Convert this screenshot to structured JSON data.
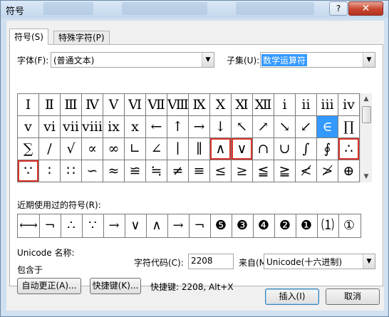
{
  "dialog": {
    "title": "符号",
    "help_glyph": "?",
    "close_glyph": "✕"
  },
  "tabs": [
    "符号(S)",
    "特殊字符(P)"
  ],
  "font": {
    "label": "字体(F):",
    "value": "(普通文本)"
  },
  "subset": {
    "label": "子集(U):",
    "value": "数学运算符"
  },
  "symbols": [
    [
      "Ⅰ",
      "Ⅱ",
      "Ⅲ",
      "Ⅳ",
      "Ⅴ",
      "Ⅵ",
      "Ⅶ",
      "Ⅷ",
      "Ⅸ",
      "Ⅹ",
      "Ⅺ",
      "Ⅻ",
      "ⅰ",
      "ⅱ",
      "ⅲ",
      "ⅳ"
    ],
    [
      "ⅴ",
      "ⅵ",
      "ⅶ",
      "ⅷ",
      "ⅸ",
      "ⅹ",
      "←",
      "↑",
      "→",
      "↓",
      "↖",
      "↗",
      "↘",
      "↙",
      "∈",
      "∏"
    ],
    [
      "∑",
      "∕",
      "√",
      "∝",
      "∞",
      "∟",
      "∠",
      "∣",
      "∥",
      "∧",
      "∨",
      "∩",
      "∪",
      "∫",
      "∮",
      "∴"
    ],
    [
      "∵",
      "∶",
      "∷",
      "∽",
      "≈",
      "≌",
      "≒",
      "≠",
      "≡",
      "≤",
      "≥",
      "≦",
      "≧",
      "≮",
      "≯",
      "⊕"
    ]
  ],
  "recent": {
    "label": "近期使用过的符号(R):",
    "items": [
      "⟷",
      "¬",
      "∴",
      "∵",
      "→",
      "∨",
      "∧",
      "→",
      "¬",
      "❺",
      "❸",
      "❹",
      "❷",
      "❶",
      "⑴",
      "①"
    ]
  },
  "unicode": {
    "name_label": "Unicode 名称:",
    "name_value": "包含于"
  },
  "charcode": {
    "label": "字符代码(C):",
    "value": "2208"
  },
  "from": {
    "label": "来自(M):",
    "value": "Unicode(十六进制)"
  },
  "buttons": {
    "autocorrect": "自动更正(A)...",
    "shortcut": "快捷键(K)...",
    "shortcut_info": "快捷键: 2208, Alt+X",
    "insert": "插入(I)",
    "cancel": "取消"
  },
  "arrow_glyph": "▼"
}
